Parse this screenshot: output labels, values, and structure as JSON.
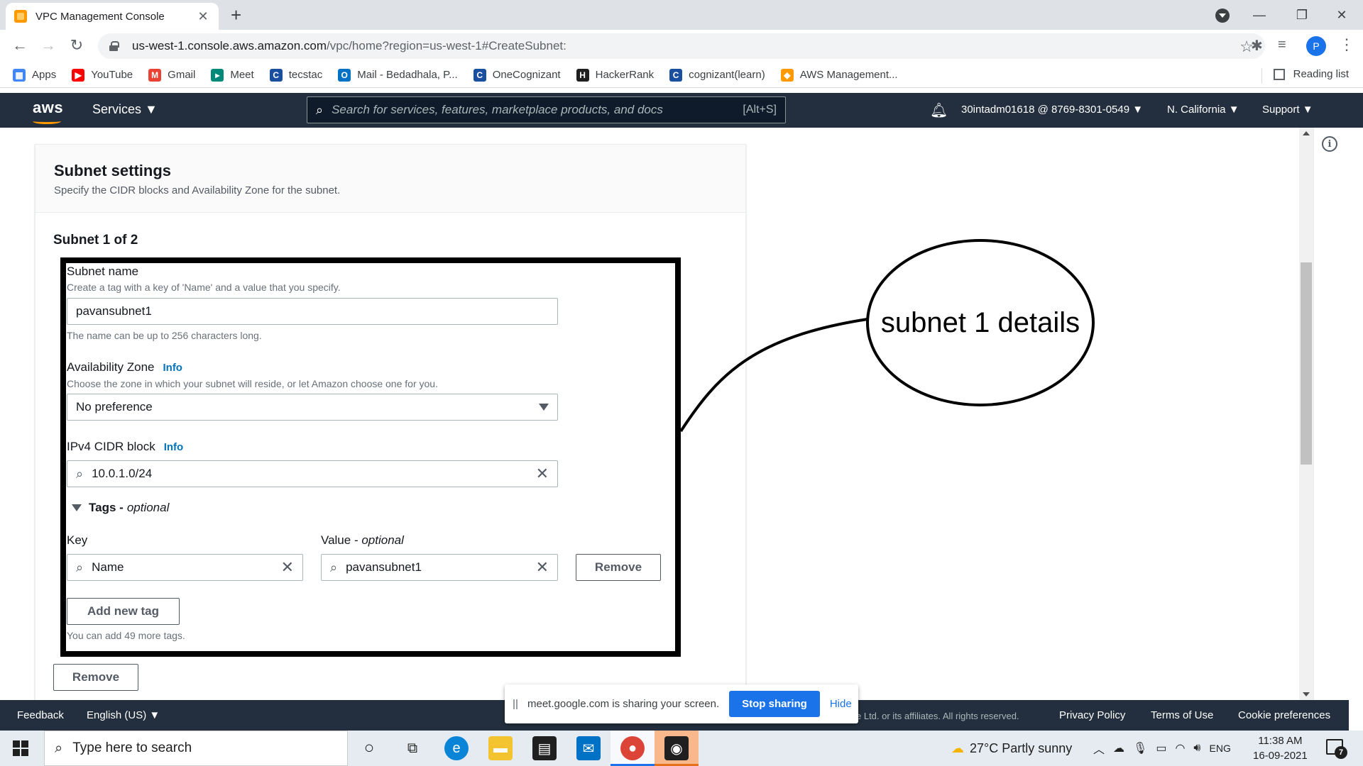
{
  "browser": {
    "tab_title": "VPC Management Console",
    "tab_close": "✕",
    "new_tab": "+",
    "url_host": "us-west-1.console.aws.amazon.com",
    "url_path": "/vpc/home?region=us-west-1#CreateSubnet:",
    "profile_initial": "P",
    "window_controls": [
      "—",
      "❐",
      "✕"
    ]
  },
  "bookmarks": [
    {
      "label": "Apps",
      "icon": "apps-grid-icon",
      "color": "#4285f4"
    },
    {
      "label": "YouTube",
      "icon": "youtube-icon",
      "color": "#ff0000"
    },
    {
      "label": "Gmail",
      "icon": "gmail-icon",
      "color": "#ea4335"
    },
    {
      "label": "Meet",
      "icon": "meet-icon",
      "color": "#00897b"
    },
    {
      "label": "tecstac",
      "icon": "tecstac-icon",
      "color": "#1a4fa0"
    },
    {
      "label": "Mail - Bedadhala, P...",
      "icon": "outlook-icon",
      "color": "#0072c6"
    },
    {
      "label": "OneCognizant",
      "icon": "onecognizant-icon",
      "color": "#1a4fa0"
    },
    {
      "label": "HackerRank",
      "icon": "hackerrank-icon",
      "color": "#1f1f1f"
    },
    {
      "label": "cognizant(learn)",
      "icon": "cognizant-learn-icon",
      "color": "#1a4fa0"
    },
    {
      "label": "AWS Management...",
      "icon": "aws-icon",
      "color": "#ff9900"
    }
  ],
  "reading_list": "Reading list",
  "aws": {
    "logo": "aws",
    "services": "Services ▼",
    "search_placeholder": "Search for services, features, marketplace products, and docs",
    "search_shortcut": "[Alt+S]",
    "account": "30intadm01618 @ 8769-8301-0549 ▼",
    "region": "N. California ▼",
    "support": "Support ▼"
  },
  "panel": {
    "title": "Subnet settings",
    "description": "Specify the CIDR blocks and Availability Zone for the subnet.",
    "subnet_count": "Subnet 1 of 2"
  },
  "form": {
    "subnet_name_label": "Subnet name",
    "subnet_name_desc": "Create a tag with a key of 'Name' and a value that you specify.",
    "subnet_name_value": "pavansubnet1",
    "subnet_name_hint": "The name can be up to 256 characters long.",
    "az_label": "Availability Zone",
    "info": "Info",
    "az_desc": "Choose the zone in which your subnet will reside, or let Amazon choose one for you.",
    "az_value": "No preference",
    "cidr_label": "IPv4 CIDR block",
    "cidr_value": "10.0.1.0/24",
    "tags_label": "Tags -",
    "tags_optional": "optional",
    "key_label": "Key",
    "value_label": "Value -",
    "value_optional": "optional",
    "tag_key": "Name",
    "tag_value": "pavansubnet1",
    "remove_tag": "Remove",
    "add_tag": "Add new tag",
    "tags_hint": "You can add 49 more tags.",
    "remove_subnet": "Remove"
  },
  "annotation": {
    "callout_text": "subnet 1 details"
  },
  "footer": {
    "feedback": "Feedback",
    "language": "English (US) ▼",
    "copyright": "e Ltd. or its affiliates. All rights reserved.",
    "privacy": "Privacy Policy",
    "terms": "Terms of Use",
    "cookies": "Cookie preferences"
  },
  "share_bar": {
    "message": "meet.google.com is sharing your screen.",
    "stop": "Stop sharing",
    "hide": "Hide"
  },
  "taskbar": {
    "search_placeholder": "Type here to search",
    "weather": "27°C  Partly sunny",
    "language": "ENG",
    "time": "11:38 AM",
    "date": "16-09-2021",
    "notification_count": "7"
  }
}
